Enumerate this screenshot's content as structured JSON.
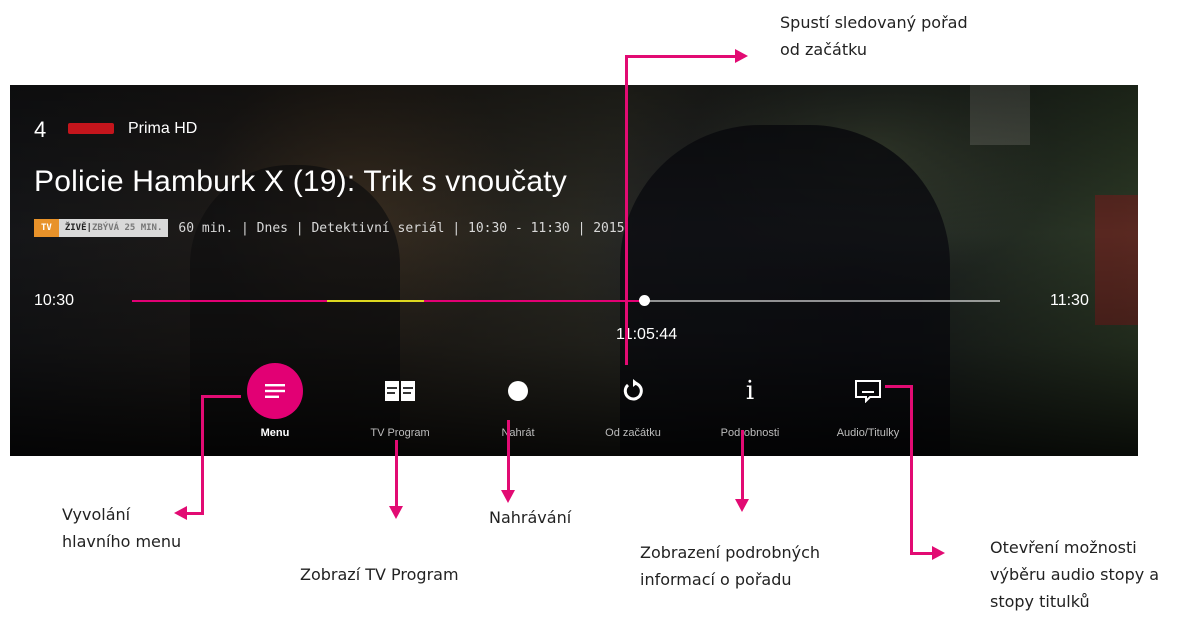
{
  "player": {
    "channel_number": "4",
    "channel_name": "Prima HD",
    "title": "Policie Hamburk X (19): Trik s vnoučaty",
    "badge_tv": "TV",
    "badge_live": "ŽIVĚ",
    "badge_remaining": "ZBÝVÁ 25 MIN.",
    "meta": "60 min. | Dnes | Detektivní seriál | 10:30 - 11:30 | 2015",
    "time_start": "10:30",
    "time_end": "11:30",
    "current_time": "11:05:44",
    "progress_fraction": 0.59,
    "accent_color": "#e20074",
    "live_color": "#ddd820"
  },
  "controls": [
    {
      "label": "Menu",
      "icon": "menu-icon",
      "active": true
    },
    {
      "label": "TV Program",
      "icon": "tv-program-icon",
      "active": false
    },
    {
      "label": "Nahrát",
      "icon": "record-icon",
      "active": false
    },
    {
      "label": "Od začátku",
      "icon": "restart-icon",
      "active": false
    },
    {
      "label": "Podrobnosti",
      "icon": "info-icon",
      "active": false
    },
    {
      "label": "Audio/Titulky",
      "icon": "subtitles-icon",
      "active": false
    }
  ],
  "annotations": {
    "restart_l1": "Spustí sledovaný pořad",
    "restart_l2": "od začátku",
    "menu_l1": "Vyvolání",
    "menu_l2": "hlavního menu",
    "program": "Zobrazí TV Program",
    "record": "Nahrávání",
    "info_l1": "Zobrazení podrobných",
    "info_l2": "informací o pořadu",
    "audio_l1": "Otevření možnosti",
    "audio_l2": "výběru audio stopy a",
    "audio_l3": "stopy titulků",
    "arrow_color": "#e20b73"
  }
}
